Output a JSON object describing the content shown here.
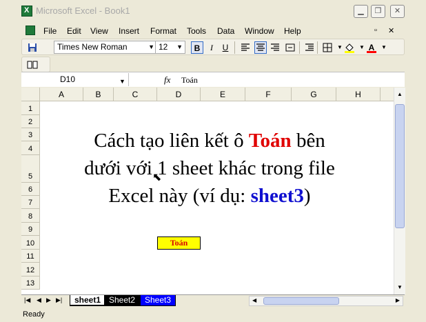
{
  "window": {
    "title": "Microsoft Excel - Book1",
    "minimize": "▁",
    "restore": "❐",
    "close": "✕"
  },
  "menu": {
    "items": [
      "File",
      "Edit",
      "View",
      "Insert",
      "Format",
      "Tools",
      "Data",
      "Window",
      "Help"
    ],
    "mdi_restore": "▫",
    "mdi_close": "✕"
  },
  "toolbar": {
    "font_name": "Times New Roman",
    "font_size": "12",
    "bold": "B",
    "italic": "I",
    "underline": "U",
    "font_color_label": "A"
  },
  "formula_bar": {
    "name_box": "D10",
    "fx": "fx",
    "value": "Toán"
  },
  "grid": {
    "columns": [
      "A",
      "B",
      "C",
      "D",
      "E",
      "F",
      "G",
      "H"
    ],
    "rows": [
      "1",
      "2",
      "3",
      "4",
      "5",
      "6",
      "7",
      "8",
      "9",
      "10",
      "11",
      "12",
      "13"
    ],
    "text_line1_prefix": "Cách tạo liên kết ô ",
    "text_line1_highlight": "Toán",
    "text_line1_suffix": " bên",
    "text_line2": "dưới với 1 sheet khác trong file",
    "text_line3_prefix": "Excel này (ví dụ: ",
    "text_line3_highlight": "sheet3",
    "text_line3_suffix": ")",
    "d10_value": "Toán"
  },
  "sheets": {
    "tabs": [
      "sheet1",
      "Sheet2",
      "Sheet3"
    ],
    "active": "sheet1"
  },
  "status": {
    "text": "Ready"
  },
  "colors": {
    "highlight_red": "#e00000",
    "highlight_blue": "#1010d0",
    "cell_fill": "#ffff00"
  }
}
